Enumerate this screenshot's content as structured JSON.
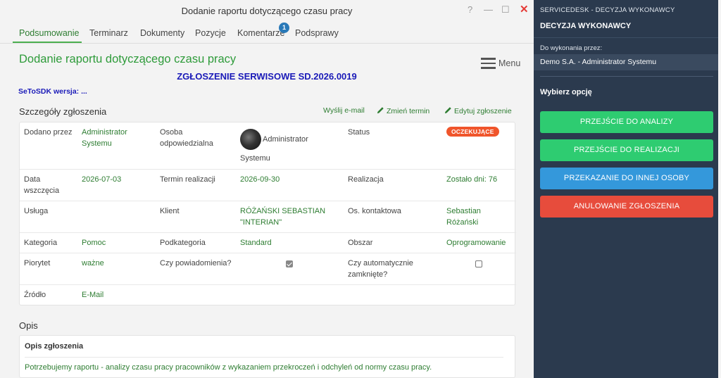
{
  "window": {
    "title": "Dodanie raportu dotyczącego czasu pracy",
    "help": "?",
    "minimize": "—",
    "maximize": "☐",
    "close": "✕"
  },
  "tabs": [
    "Podsumowanie",
    "Terminarz",
    "Dokumenty",
    "Pozycje",
    "Komentarze",
    "Podsprawy"
  ],
  "tab_badge": "1",
  "page": {
    "title": "Dodanie raportu dotyczącego czasu pracy",
    "menu_label": "Menu",
    "ticket_number": "ZGŁOSZENIE SERWISOWE SD.2026.0019",
    "sdk_version": "SeToSDK wersja: ..."
  },
  "details": {
    "heading": "Szczegóły zgłoszenia",
    "actions": {
      "send_email": "Wyślij e-mail",
      "change_date": "Zmień termin",
      "edit": "Edytuj zgłoszenie"
    },
    "added_by_label": "Dodano przez",
    "added_by_value_1": "Administrator",
    "added_by_value_2": "Systemu",
    "owner_label_1": "Osoba",
    "owner_label_2": "odpowiedzialna",
    "owner_value_1": "Administrator",
    "owner_value_2": "Systemu",
    "status_label": "Status",
    "status_value": "OCZEKUJĄCE",
    "start_label_1": "Data",
    "start_label_2": "wszczęcia",
    "start_value": "2026-07-03",
    "deadline_label": "Termin realizacji",
    "deadline_value": "2026-09-30",
    "realization_label": "Realizacja",
    "realization_value": "Zostało dni: 76",
    "service_label": "Usługa",
    "client_label": "Klient",
    "client_value_1": "RÓŻAŃSKI SEBASTIAN",
    "client_value_2": "\"INTERIAN\"",
    "contact_label": "Os. kontaktowa",
    "contact_value_1": "Sebastian",
    "contact_value_2": "Różański",
    "category_label": "Kategoria",
    "category_value": "Pomoc",
    "subcategory_label": "Podkategoria",
    "subcategory_value": "Standard",
    "area_label": "Obszar",
    "area_value": "Oprogramowanie",
    "priority_label": "Piorytet",
    "priority_value": "ważne",
    "notify_label": "Czy powiadomienia?",
    "notify_checked": true,
    "autoclose_label_1": "Czy automatycznie",
    "autoclose_label_2": "zamknięte?",
    "autoclose_checked": false,
    "source_label": "Źródło",
    "source_value": "E-Mail"
  },
  "description": {
    "heading": "Opis",
    "card_title": "Opis zgłoszenia",
    "text": "Potrzebujemy raportu - analizy czasu pracy pracowników z wykazaniem przekroczeń i odchyleń od normy czasu pracy."
  },
  "sidebar": {
    "header": "SERVICEDESK - DECYZJA WYKONAWCY",
    "title": "DECYZJA WYKONAWCY",
    "assignee_label": "Do wykonania przez:",
    "assignee_value": "Demo S.A. - Administrator Systemu",
    "choose_label": "Wybierz opcję",
    "options": [
      {
        "label": "PRZEJŚCIE DO ANALIZY",
        "color": "#2ecc71"
      },
      {
        "label": "PRZEJŚCIE DO REALIZACJI",
        "color": "#2ecc71"
      },
      {
        "label": "PRZEKAZANIE DO INNEJ OSOBY",
        "color": "#3498db"
      },
      {
        "label": "ANULOWANIE ZGŁOSZENIA",
        "color": "#e74c3c"
      }
    ]
  },
  "colors": {
    "accent_green": "#2e7d32",
    "title_green": "#2e9b3a",
    "ticket_blue": "#1a1ab8",
    "status_orange": "#f0552b",
    "sidebar_bg": "#2b3a4e"
  }
}
